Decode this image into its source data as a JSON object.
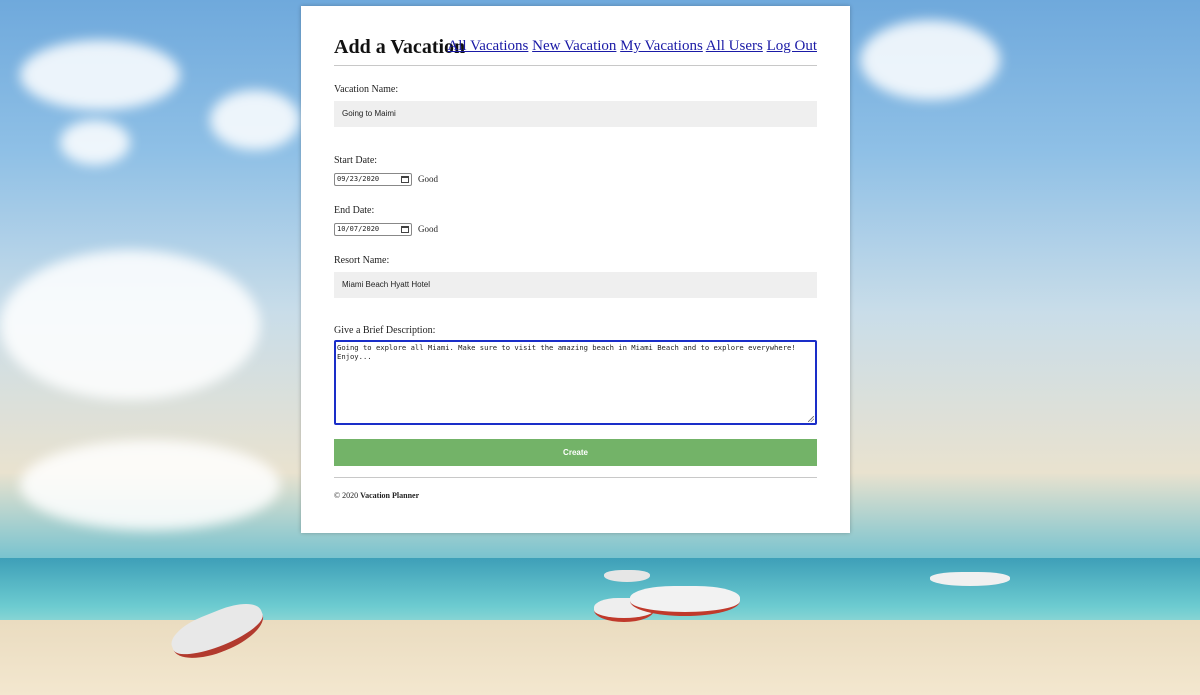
{
  "header": {
    "title": "Add a Vacation",
    "nav": [
      "All Vacations",
      "New Vacation",
      "My Vacations",
      "All Users",
      "Log Out"
    ]
  },
  "form": {
    "vacation_name_label": "Vacation Name:",
    "vacation_name_value": "Going to Maimi",
    "start_date_label": "Start Date:",
    "start_date_value": "09/23/2020",
    "start_date_status": "Good",
    "end_date_label": "End Date:",
    "end_date_value": "10/07/2020",
    "end_date_status": "Good",
    "resort_name_label": "Resort Name:",
    "resort_name_value": "Miami Beach Hyatt Hotel",
    "description_label": "Give a Brief Description:",
    "description_value": "Going to explore all Miami. Make sure to visit the amazing beach in Miami Beach and to explore everywhere! Enjoy...",
    "create_label": "Create"
  },
  "footer": {
    "copyright": "© 2020",
    "brand": "Vacation Planner"
  },
  "colors": {
    "button": "#73b368",
    "link": "#1a1aa6",
    "focus_border": "#1a2ec8"
  }
}
